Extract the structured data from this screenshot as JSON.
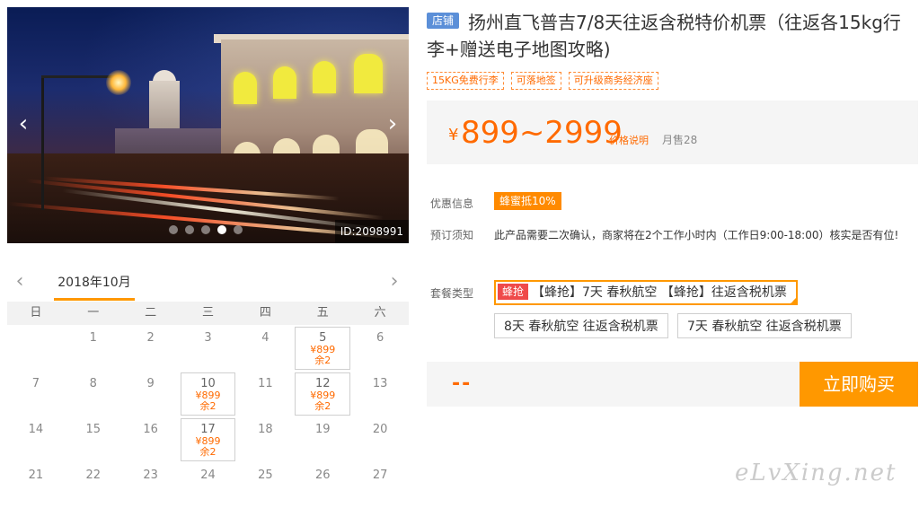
{
  "gallery": {
    "photo_id": "ID:2098991",
    "slide_count": 5,
    "active_slide": 4,
    "prev_icon": "chevron-left-icon",
    "next_icon": "chevron-right-icon"
  },
  "calendar": {
    "month_label": "2018年10月",
    "weekdays": [
      "日",
      "一",
      "二",
      "三",
      "四",
      "五",
      "六"
    ],
    "weeks": [
      [
        {
          "day": ""
        },
        {
          "day": "1"
        },
        {
          "day": "2"
        },
        {
          "day": "3"
        },
        {
          "day": "4"
        },
        {
          "day": "5",
          "price": "¥899",
          "stock": "余2"
        },
        {
          "day": "6"
        }
      ],
      [
        {
          "day": "7"
        },
        {
          "day": "8"
        },
        {
          "day": "9"
        },
        {
          "day": "10",
          "price": "¥899",
          "stock": "余2"
        },
        {
          "day": "11"
        },
        {
          "day": "12",
          "price": "¥899",
          "stock": "余2"
        },
        {
          "day": "13"
        }
      ],
      [
        {
          "day": "14"
        },
        {
          "day": "15"
        },
        {
          "day": "16"
        },
        {
          "day": "17",
          "price": "¥899",
          "stock": "余2"
        },
        {
          "day": "18"
        },
        {
          "day": "19"
        },
        {
          "day": "20"
        }
      ],
      [
        {
          "day": "21"
        },
        {
          "day": "22"
        },
        {
          "day": "23"
        },
        {
          "day": "24"
        },
        {
          "day": "25"
        },
        {
          "day": "26"
        },
        {
          "day": "27"
        }
      ]
    ]
  },
  "product": {
    "store_badge": "店铺",
    "title": "扬州直飞普吉7/8天往返含税特价机票（往返各15kg行李+赠送电子地图攻略)",
    "tags": [
      "15KG免费行李",
      "可落地签",
      "可升级商务经济座"
    ]
  },
  "price": {
    "currency": "¥",
    "range": "899~2999",
    "explain_link": "价格说明",
    "monthly_sales": "月售28"
  },
  "info": {
    "promo_label": "优惠信息",
    "promo_tag": "蜂蜜抵10%",
    "notice_label": "预订须知",
    "notice_text": "此产品需要二次确认，商家将在2个工作小时内（工作日9:00-18:00）核实是否有位!"
  },
  "packages": {
    "label": "套餐类型",
    "flash_badge": "蜂抢",
    "items": [
      {
        "label": "【蜂抢】7天 春秋航空 【蜂抢】往返含税机票",
        "selected": true
      },
      {
        "label": "8天 春秋航空 往返含税机票",
        "selected": false
      },
      {
        "label": "7天 春秋航空 往返含税机票",
        "selected": false
      }
    ]
  },
  "purchase": {
    "total": "--",
    "buy_label": "立即购买"
  },
  "watermark": "eLvXing.net",
  "colors": {
    "accent": "#ff9800",
    "price": "#ff6a00",
    "store_badge": "#5b8fd8",
    "flash_badge": "#ef4a4a"
  }
}
